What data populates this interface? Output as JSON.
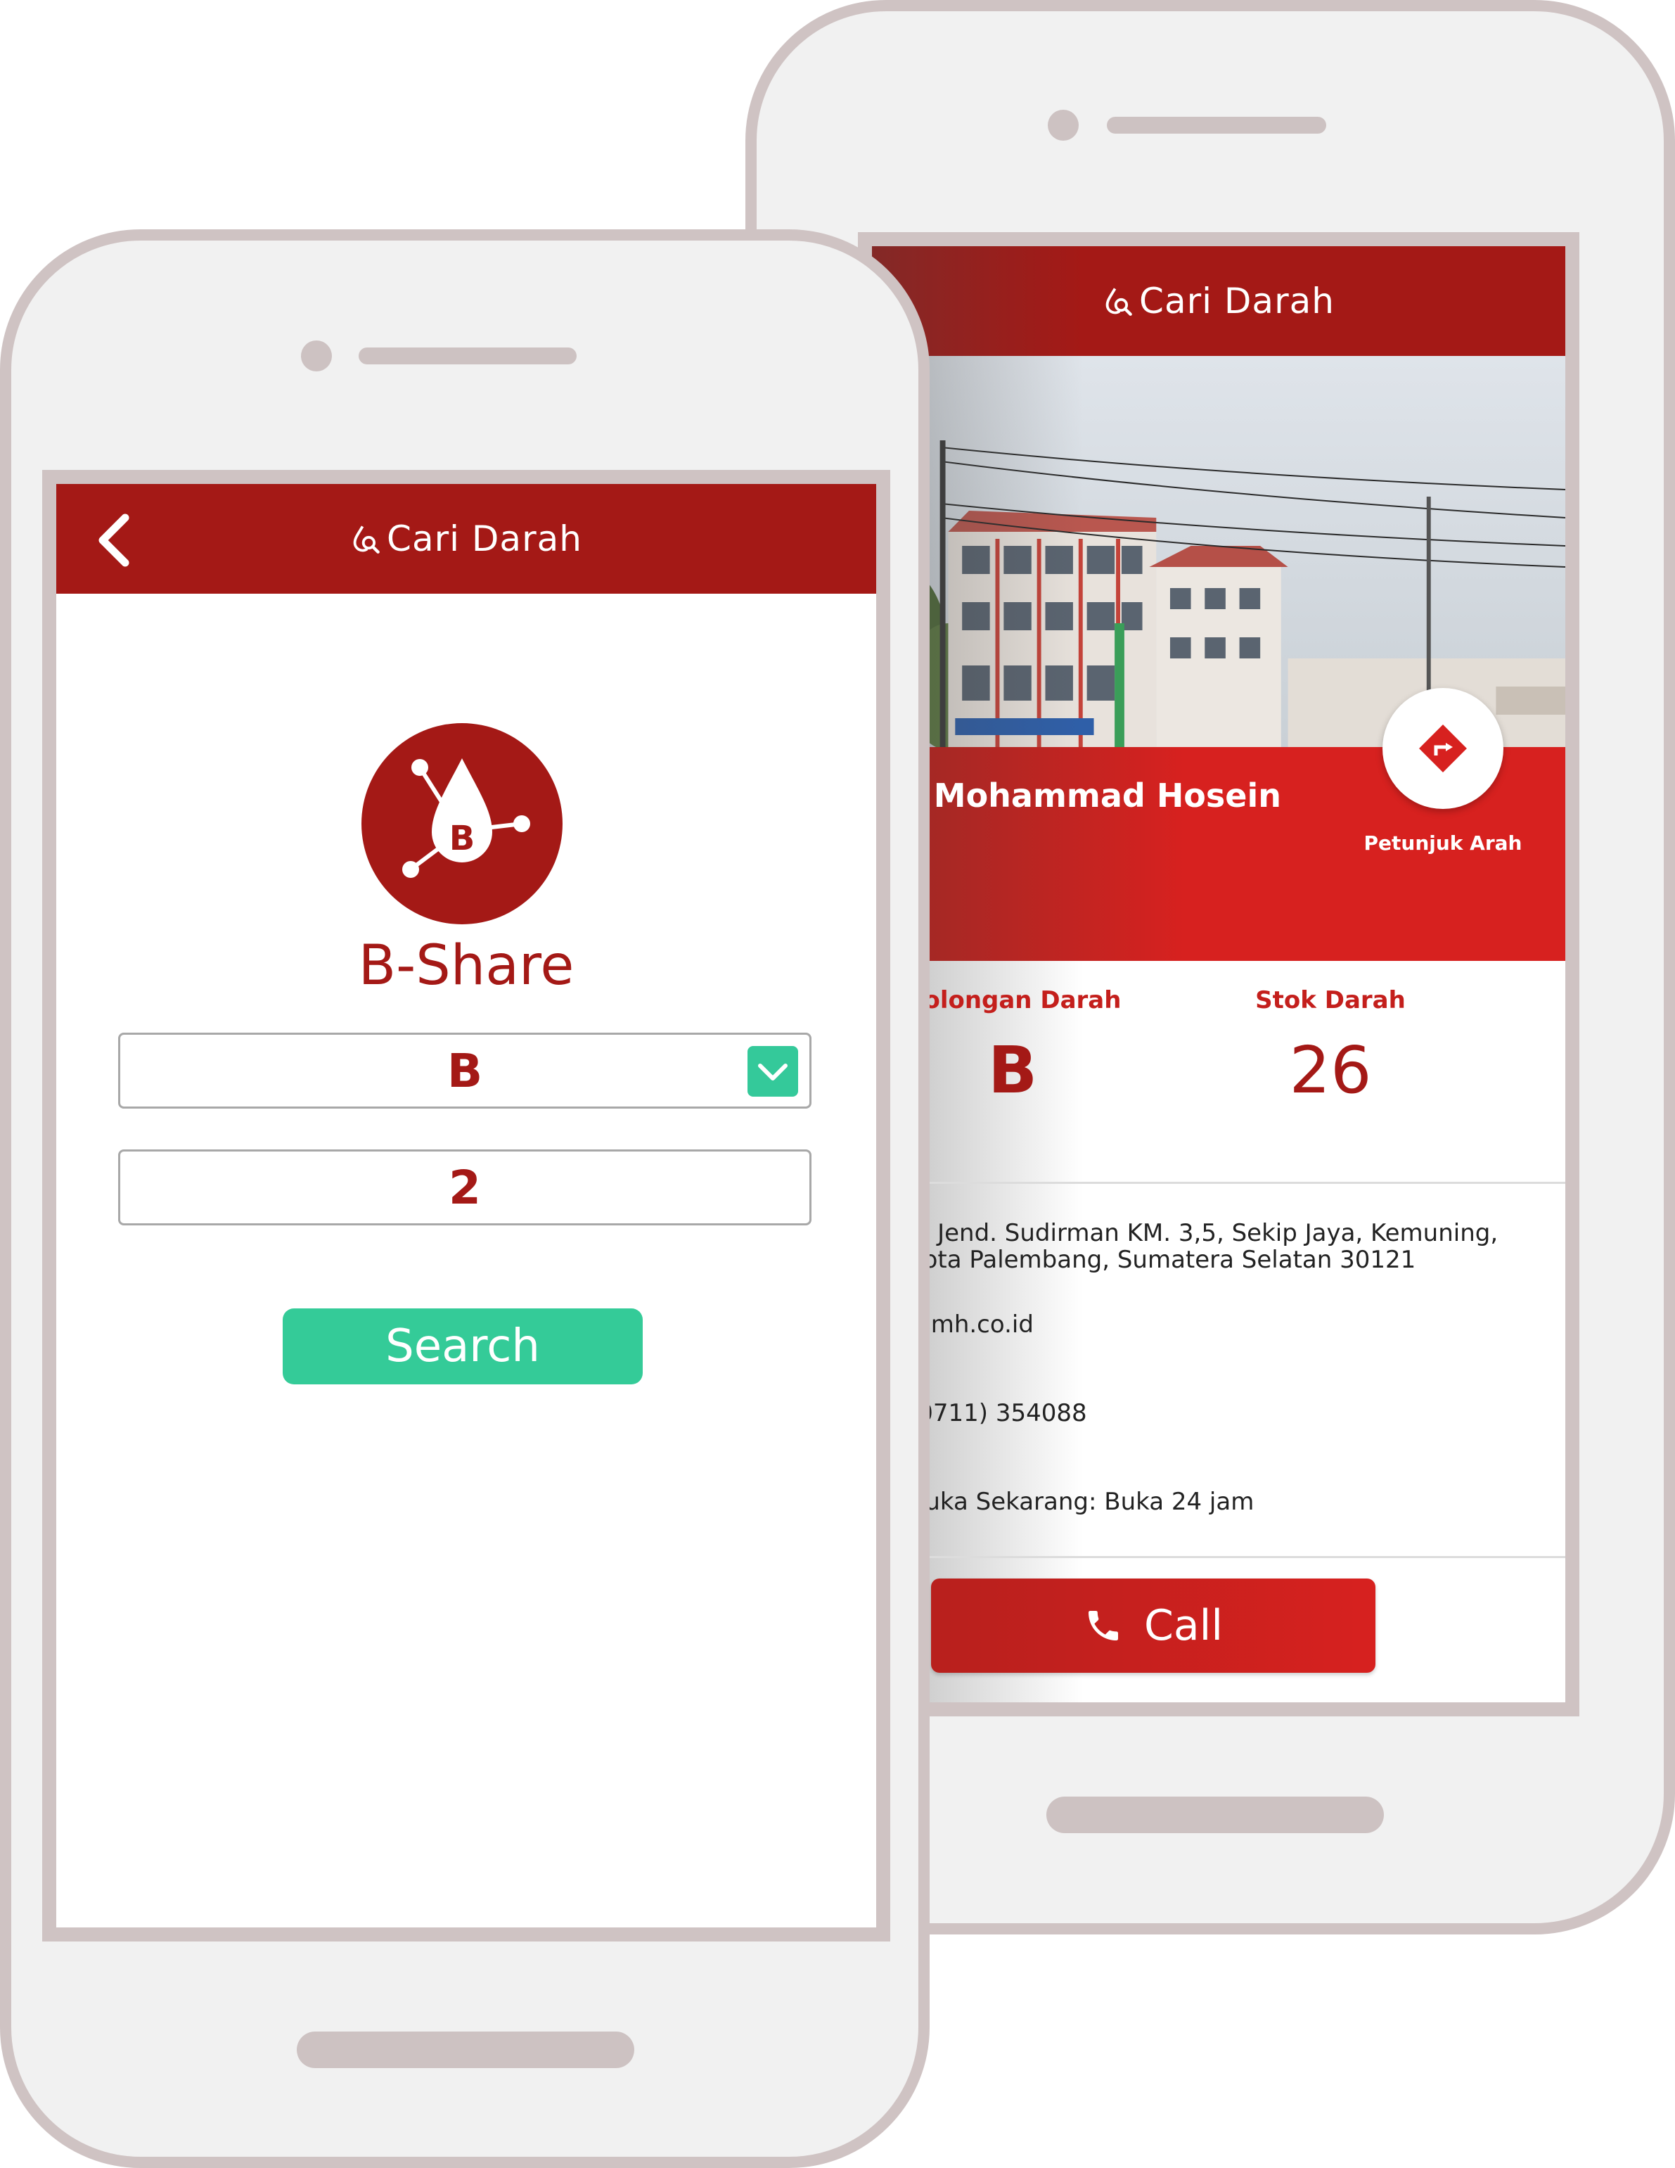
{
  "back_screen": {
    "appbar": {
      "title": "Cari Darah",
      "icon": "blood-drop-search-icon"
    },
    "hospital": {
      "name": "Dr. Mohammad Hosein",
      "direction_label": "Petunjuk Arah",
      "direction_icon": "turn-right-diamond-icon"
    },
    "stats": {
      "blood_type_label": "Golongan Darah",
      "blood_type_value": "B",
      "stock_label": "Stok Darah",
      "stock_value": "26"
    },
    "details": {
      "address_line1": "Jl. Jend. Sudirman KM. 3,5, Sekip Jaya, Kemuning,",
      "address_line2": "Kota Palembang, Sumatera Selatan 30121",
      "website": "rsmh.co.id",
      "phone": "(0711) 354088",
      "hours": "Buka Sekarang: Buka 24 jam"
    },
    "call_button": {
      "label": "Call",
      "icon": "phone-icon"
    }
  },
  "front_screen": {
    "appbar": {
      "title": "Cari Darah",
      "back_icon": "chevron-left-icon",
      "icon": "blood-drop-search-icon"
    },
    "logo": {
      "letter": "B",
      "icon": "blood-drop-network-icon"
    },
    "app_name": "B-Share",
    "blood_type_select": {
      "value": "B",
      "toggle_icon": "chevron-down-icon"
    },
    "quantity_input": {
      "value": "2"
    },
    "search_button": {
      "label": "Search"
    }
  },
  "colors": {
    "primary_red": "#a41916",
    "banner_red": "#d7211f",
    "accent_green": "#34cb98",
    "phone_frame": "#cfc3c3"
  }
}
